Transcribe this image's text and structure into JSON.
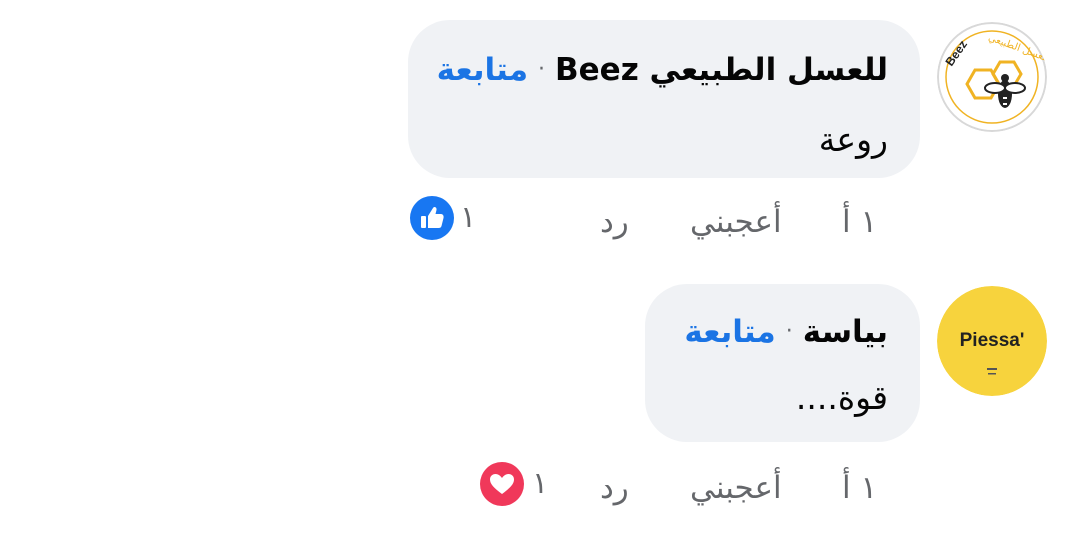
{
  "comments": [
    {
      "author": "للعسل الطبيعي Beez",
      "separator": "·",
      "follow_label": "متابعة",
      "text": "روعة",
      "time": "١ أ",
      "like_label": "أعجبني",
      "reply_label": "رد",
      "reaction_count": "١",
      "reaction_type": "like-icon",
      "avatar_name": "beez-logo",
      "avatar_text": "Beez للعسل الطبيعي"
    },
    {
      "author": "بياسة",
      "separator": "·",
      "follow_label": "متابعة",
      "text": "قوة....",
      "time": "١ أ",
      "like_label": "أعجبني",
      "reply_label": "رد",
      "reaction_count": "١",
      "reaction_type": "love-icon",
      "avatar_name": "piessa-logo",
      "avatar_text": "Piessa'"
    }
  ],
  "colors": {
    "bubble": "#f0f2f5",
    "follow": "#1b74e4",
    "meta": "#65676b",
    "like": "#1877f2",
    "love": "#f0385a",
    "piessa_bg": "#f7d33d",
    "honey": "#f0b323"
  }
}
